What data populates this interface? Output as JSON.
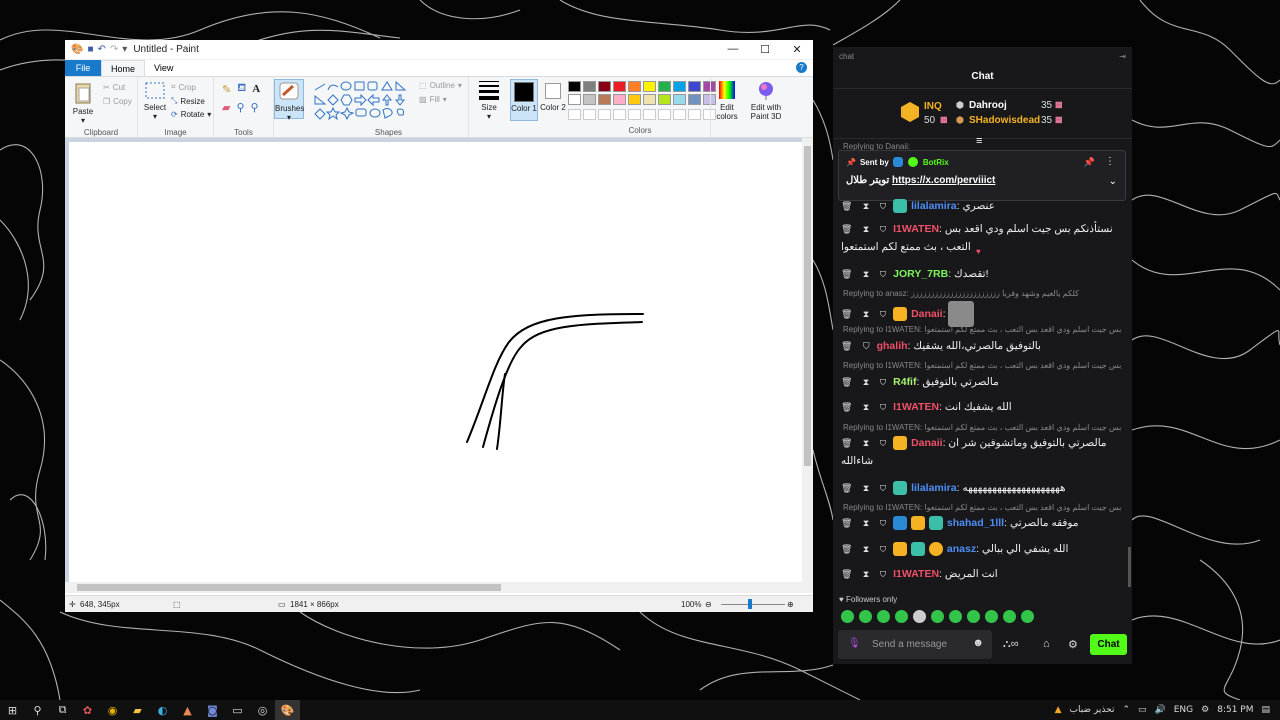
{
  "paint": {
    "window_title": "Untitled - Paint",
    "tabs": {
      "file": "File",
      "home": "Home",
      "view": "View"
    },
    "clipboard": {
      "paste": "Paste",
      "cut": "Cut",
      "copy": "Copy",
      "label": "Clipboard"
    },
    "image": {
      "select": "Select",
      "crop": "Crop",
      "resize": "Resize",
      "rotate": "Rotate",
      "label": "Image"
    },
    "tools": {
      "label": "Tools",
      "brushes": "Brushes"
    },
    "shapes": {
      "outline": "Outline",
      "fill": "Fill",
      "label": "Shapes"
    },
    "size": "Size",
    "color1": "Color 1",
    "color2": "Color 2",
    "colors_label": "Colors",
    "edit_colors": "Edit colors",
    "edit_paint3d": "Edit with Paint 3D",
    "palette": [
      "#000000",
      "#7f7f7f",
      "#880015",
      "#ed1c24",
      "#ff7f27",
      "#fff200",
      "#22b14c",
      "#00a2e8",
      "#3f48cc",
      "#a349a4",
      "#ffffff",
      "#c3c3c3",
      "#b97a57",
      "#ffaec9",
      "#ffc90e",
      "#efe4b0",
      "#b5e61d",
      "#99d9ea",
      "#7092be",
      "#c8bfe7"
    ],
    "status": {
      "cursor": "648, 345px",
      "canvas_size": "1841 × 866px",
      "zoom": "100%"
    }
  },
  "chat": {
    "header": "chat",
    "title": "Chat",
    "leaderboard": [
      {
        "rank": "",
        "name": "INQ",
        "score": "50"
      },
      {
        "name": "Dahrooj",
        "score": "35"
      },
      {
        "name": "SHadowisdead",
        "score": "35"
      }
    ],
    "reply_top": "Replying to Danaii:",
    "pinned": {
      "sent_by": "Sent by",
      "bot": "BotRix",
      "text": "تويتر طلال",
      "link": "https://x.com/perviiict"
    },
    "messages": [
      {
        "user": "lilalamira",
        "color": "#4e8ff7",
        "text": "عنصري"
      },
      {
        "user": "I1WATEN",
        "color": "#f25068",
        "text": "نستأذنكم بس جيت اسلم ودي اقعد بس التعب ، بث ممتع لكم استمتعوا"
      },
      {
        "user": "JORY_7RB",
        "color": "#7bf55b",
        "text": "تقصدك!"
      },
      {
        "reply": "Replying to anasz: كلكم يالغيم وشهد وفريا ززززززززززززززززززززززز"
      },
      {
        "user": "Danaii",
        "color": "#f25068",
        "text": ""
      },
      {
        "reply": "Replying to I1WATEN: نستأذنكم بس جيت اسلم ودي اقعد بس التعب ، بث ممتع لكم استمتعوا..."
      },
      {
        "user": "ghalih",
        "color": "#f25068",
        "text": "بالتوفيق مالصرتي،الله يشفيك"
      },
      {
        "reply": "Replying to I1WATEN: نستأذنكم بس جيت اسلم ودي اقعد بس التعب ، بث ممتع لكم استمتعوا..."
      },
      {
        "user": "R4fif",
        "color": "#a6f36d",
        "text": "مالصرتي بالتوفيق"
      },
      {
        "user": "I1WATEN",
        "color": "#f25068",
        "text": "الله يشفيك انت"
      },
      {
        "reply": "Replying to I1WATEN: نستأذنكم بس جيت اسلم ودي اقعد بس التعب ، بث ممتع لكم استمتعوا..."
      },
      {
        "user": "Danaii",
        "color": "#f25068",
        "text": "مالصرتي بالتوفيق وماتشوفين شر ان شاءالله"
      },
      {
        "user": "lilalamira",
        "color": "#4e8ff7",
        "text": "ههههههههههههههههههههه"
      },
      {
        "reply": "Replying to I1WATEN: نستأذنكم بس جيت اسلم ودي اقعد بس التعب ، بث ممتع لكم استمتعوا..."
      },
      {
        "user": "shahad_1lll",
        "color": "#4e8ff7",
        "text": "موفقه مالصرتي"
      },
      {
        "user": "anasz",
        "color": "#4e8ff7",
        "text": "الله يشفي الي ببالي"
      },
      {
        "user": "I1WATEN",
        "color": "#f25068",
        "text": "انت المريض"
      }
    ],
    "followers_only": "Followers only",
    "input_placeholder": "Send a message",
    "chat_button": "Chat"
  },
  "taskbar": {
    "weather": "تحذير ضباب",
    "lang": "ENG",
    "time": "8:51 PM"
  }
}
